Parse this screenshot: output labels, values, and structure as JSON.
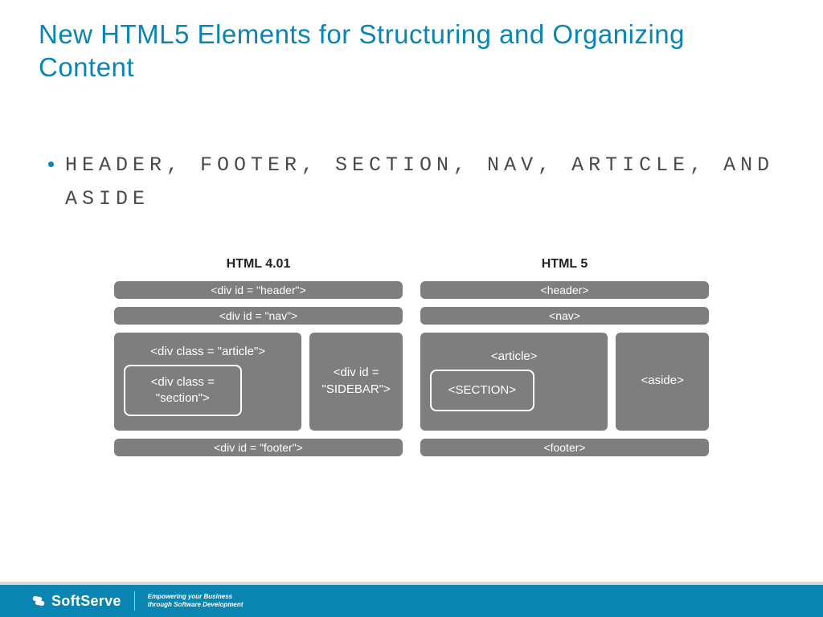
{
  "title": "New HTML5 Elements for Structuring and Organizing Content",
  "bullet": "HEADER, FOOTER, SECTION, NAV, ARTICLE, AND ASIDE",
  "diagram": {
    "left": {
      "title": "HTML 4.01",
      "header": "<div id = \"header\">",
      "nav": "<div id = \"nav\">",
      "article": "<div class = \"article\">",
      "section": "<div class = \"section\">",
      "sidebar": "<div id = \"SIDEBAR\">",
      "footer": "<div id = \"footer\">"
    },
    "right": {
      "title": "HTML 5",
      "header": "<header>",
      "nav": "<nav>",
      "article": "<article>",
      "section": "<SECTION>",
      "aside": "<aside>",
      "footer": "<footer>"
    }
  },
  "footer": {
    "brand": "SoftServe",
    "tagline1": "Empowering your Business",
    "tagline2": "through Software Development"
  }
}
